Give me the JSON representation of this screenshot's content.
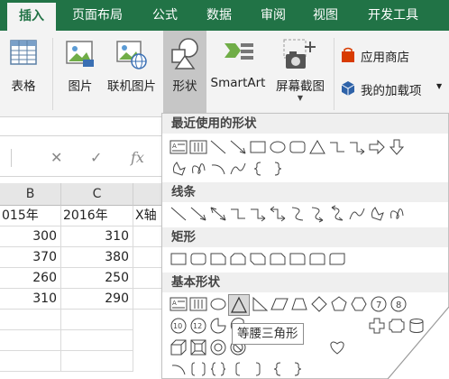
{
  "ribbon_tabs": [
    {
      "label": "插入",
      "active": true
    },
    {
      "label": "页面布局"
    },
    {
      "label": "公式"
    },
    {
      "label": "数据"
    },
    {
      "label": "审阅"
    },
    {
      "label": "视图"
    },
    {
      "label": "开发工具"
    }
  ],
  "ribbon": {
    "table": "表格",
    "picture": "图片",
    "online_picture": "联机图片",
    "shapes": "形状",
    "smartart": "SmartArt",
    "screenshot": "屏幕截图",
    "app_store": "应用商店",
    "my_addins": "我的加载项"
  },
  "formula_bar": {
    "fx": "fx"
  },
  "sheet": {
    "columns": [
      "B",
      "C"
    ],
    "rows": [
      [
        "015年",
        "2016年",
        "X轴"
      ],
      [
        "300",
        "310",
        ""
      ],
      [
        "370",
        "380",
        ""
      ],
      [
        "260",
        "250",
        ""
      ],
      [
        "310",
        "290",
        ""
      ]
    ]
  },
  "shapes_menu": {
    "sections": [
      "最近使用的形状",
      "线条",
      "矩形",
      "基本形状"
    ],
    "tooltip": "等腰三角形",
    "badges": {
      "seven": "7",
      "eight": "8",
      "ten": "10",
      "twelve": "12"
    }
  },
  "colors": {
    "ribbon_green": "#217346",
    "store_red": "#d83b01",
    "addin_blue": "#2e62a8"
  }
}
